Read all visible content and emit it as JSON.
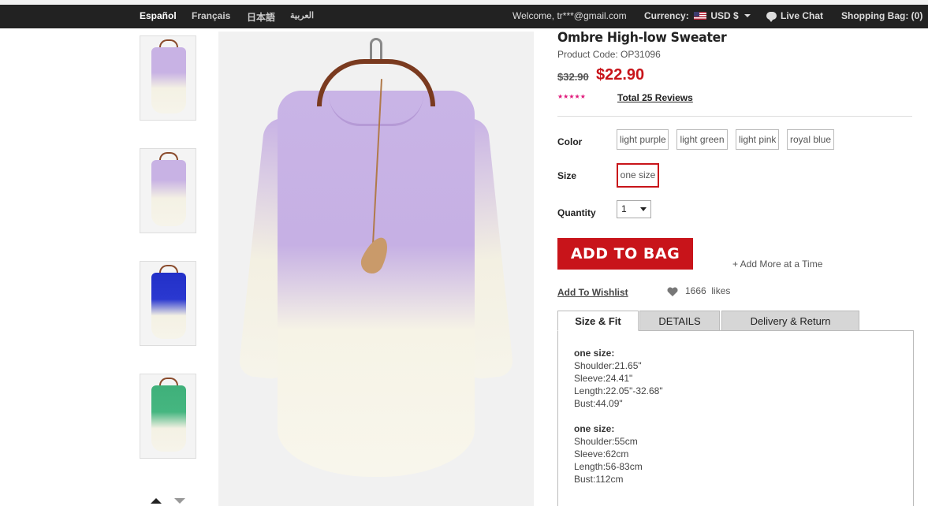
{
  "topbar": {
    "languages": [
      "Español",
      "Français",
      "日本語",
      "العربية"
    ],
    "welcome": "Welcome, tr***@gmail.com",
    "currency_label": "Currency:",
    "currency_value": "USD $",
    "live_chat": "Live Chat",
    "shopping_bag": "Shopping Bag: (0)"
  },
  "thumbnails": [
    {
      "label": "light purple"
    },
    {
      "label": "light purple"
    },
    {
      "label": "royal blue"
    },
    {
      "label": "light green"
    }
  ],
  "product": {
    "title": "Ombre High-low Sweater",
    "code": "Product Code: OP31096",
    "old_price": "$32.90",
    "new_price": "$22.90",
    "stars": "★★★★★",
    "reviews": "Total 25 Reviews"
  },
  "options": {
    "color_label": "Color",
    "colors": [
      "light purple",
      "light green",
      "light pink",
      "royal blue"
    ],
    "size_label": "Size",
    "size": "one size",
    "quantity_label": "Quantity",
    "quantity": "1"
  },
  "actions": {
    "add_to_bag": "ADD TO BAG",
    "add_more": "+ Add More at a Time",
    "wishlist": "Add To Wishlist",
    "likes_count": "1666",
    "likes_label": "likes"
  },
  "tabs": [
    "Size & Fit",
    "DETAILS",
    "Delivery & Return"
  ],
  "size_fit": {
    "inches": {
      "heading": "one size:",
      "lines": [
        "Shoulder:21.65\"",
        "Sleeve:24.41\"",
        "Length:22.05\"-32.68\"",
        "Bust:44.09\""
      ]
    },
    "cm": {
      "heading": "one size:",
      "lines": [
        "Shoulder:55cm",
        "Sleeve:62cm",
        "Length:56-83cm",
        "Bust:112cm"
      ]
    }
  },
  "colors": {
    "accent_red": "#c8141a",
    "stars_pink": "#e0187a",
    "topbar_bg": "#222222"
  }
}
